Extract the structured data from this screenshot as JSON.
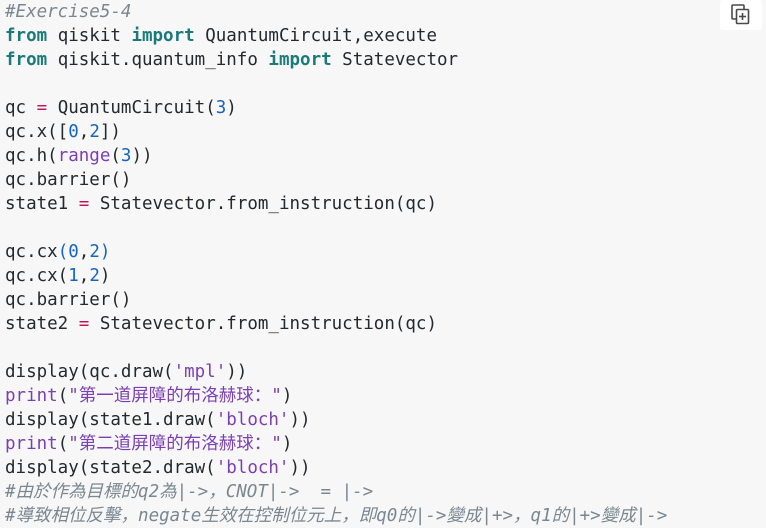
{
  "code_cell": {
    "lines": [
      {
        "parts": [
          {
            "t": "#Exercise5-4",
            "c": "cmt"
          }
        ]
      },
      {
        "parts": [
          {
            "t": "from",
            "c": "kw"
          },
          {
            "t": " qiskit ",
            "c": ""
          },
          {
            "t": "import",
            "c": "kw"
          },
          {
            "t": " QuantumCircuit,execute",
            "c": ""
          }
        ]
      },
      {
        "parts": [
          {
            "t": "from",
            "c": "kw"
          },
          {
            "t": " qiskit.quantum_info ",
            "c": ""
          },
          {
            "t": "import",
            "c": "kw"
          },
          {
            "t": " Statevector",
            "c": ""
          }
        ]
      },
      {
        "parts": []
      },
      {
        "parts": [
          {
            "t": "qc ",
            "c": ""
          },
          {
            "t": "=",
            "c": "op"
          },
          {
            "t": " QuantumCircuit(",
            "c": ""
          },
          {
            "t": "3",
            "c": "num"
          },
          {
            "t": ")",
            "c": ""
          }
        ]
      },
      {
        "parts": [
          {
            "t": "qc.x([",
            "c": ""
          },
          {
            "t": "0",
            "c": "num"
          },
          {
            "t": ",",
            "c": ""
          },
          {
            "t": "2",
            "c": "num"
          },
          {
            "t": "])",
            "c": ""
          }
        ]
      },
      {
        "parts": [
          {
            "t": "qc.h(",
            "c": ""
          },
          {
            "t": "range",
            "c": "builtin"
          },
          {
            "t": "(",
            "c": ""
          },
          {
            "t": "3",
            "c": "num"
          },
          {
            "t": "))",
            "c": ""
          }
        ]
      },
      {
        "parts": [
          {
            "t": "qc.barrier()",
            "c": ""
          }
        ]
      },
      {
        "parts": [
          {
            "t": "state1 ",
            "c": ""
          },
          {
            "t": "=",
            "c": "op"
          },
          {
            "t": " Statevector.from_instruction(qc)",
            "c": ""
          }
        ]
      },
      {
        "parts": []
      },
      {
        "parts": [
          {
            "t": "qc.cx",
            "c": ""
          },
          {
            "t": "(",
            "c": "num"
          },
          {
            "t": "0",
            "c": "num"
          },
          {
            "t": ",",
            "c": ""
          },
          {
            "t": "2",
            "c": "num"
          },
          {
            "t": ")",
            "c": "num"
          }
        ]
      },
      {
        "parts": [
          {
            "t": "qc.cx(",
            "c": ""
          },
          {
            "t": "1",
            "c": "num"
          },
          {
            "t": ",",
            "c": ""
          },
          {
            "t": "2",
            "c": "num"
          },
          {
            "t": ")",
            "c": ""
          }
        ]
      },
      {
        "parts": [
          {
            "t": "qc.barrier()",
            "c": ""
          }
        ]
      },
      {
        "parts": [
          {
            "t": "state2 ",
            "c": ""
          },
          {
            "t": "=",
            "c": "op"
          },
          {
            "t": " Statevector.from_instruction(qc)",
            "c": ""
          }
        ]
      },
      {
        "parts": []
      },
      {
        "parts": [
          {
            "t": "display(qc.draw(",
            "c": ""
          },
          {
            "t": "'mpl'",
            "c": "str"
          },
          {
            "t": "))",
            "c": ""
          }
        ]
      },
      {
        "parts": [
          {
            "t": "print",
            "c": "builtin"
          },
          {
            "t": "(",
            "c": ""
          },
          {
            "t": "\"第一道屏障的布洛赫球：\"",
            "c": "str"
          },
          {
            "t": ")",
            "c": ""
          }
        ]
      },
      {
        "parts": [
          {
            "t": "display(state1.draw(",
            "c": ""
          },
          {
            "t": "'bloch'",
            "c": "str"
          },
          {
            "t": "))",
            "c": ""
          }
        ]
      },
      {
        "parts": [
          {
            "t": "print",
            "c": "builtin"
          },
          {
            "t": "(",
            "c": ""
          },
          {
            "t": "\"第二道屏障的布洛赫球：\"",
            "c": "str"
          },
          {
            "t": ")",
            "c": ""
          }
        ]
      },
      {
        "parts": [
          {
            "t": "display(state2.draw(",
            "c": ""
          },
          {
            "t": "'bloch'",
            "c": "str"
          },
          {
            "t": "))",
            "c": ""
          }
        ]
      },
      {
        "parts": [
          {
            "t": "#由於作為目標的q2為|->，CNOT|->  = |->",
            "c": "cmt"
          }
        ]
      },
      {
        "parts": [
          {
            "t": "#導致相位反擊，negate生效在控制位元上，即q0的|->變成|+>，q1的|+>變成|->",
            "c": "cmt"
          }
        ]
      }
    ]
  },
  "toolbar": {
    "copy_icon": "copy-icon"
  }
}
